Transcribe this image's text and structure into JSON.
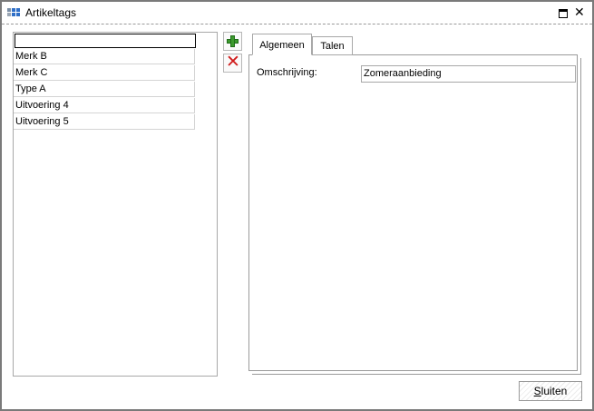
{
  "window": {
    "title": "Artikeltags",
    "icons": {
      "app": "app-grid-icon",
      "restore": "restore-icon",
      "close": "close-icon"
    }
  },
  "list": {
    "new_value": "",
    "items": [
      "Merk B",
      "Merk C",
      "Type A",
      "Uitvoering 4",
      "Uitvoering 5"
    ]
  },
  "toolbar": {
    "add_icon": "plus-icon",
    "delete_icon": "delete-x-icon"
  },
  "tabs": [
    {
      "label": "Algemeen",
      "active": true
    },
    {
      "label": "Talen",
      "active": false
    }
  ],
  "form": {
    "omschrijving_label": "Omschrijving:",
    "omschrijving_value": "Zomeraanbieding"
  },
  "footer": {
    "close_label_accel": "S",
    "close_label_rest": "luiten"
  }
}
